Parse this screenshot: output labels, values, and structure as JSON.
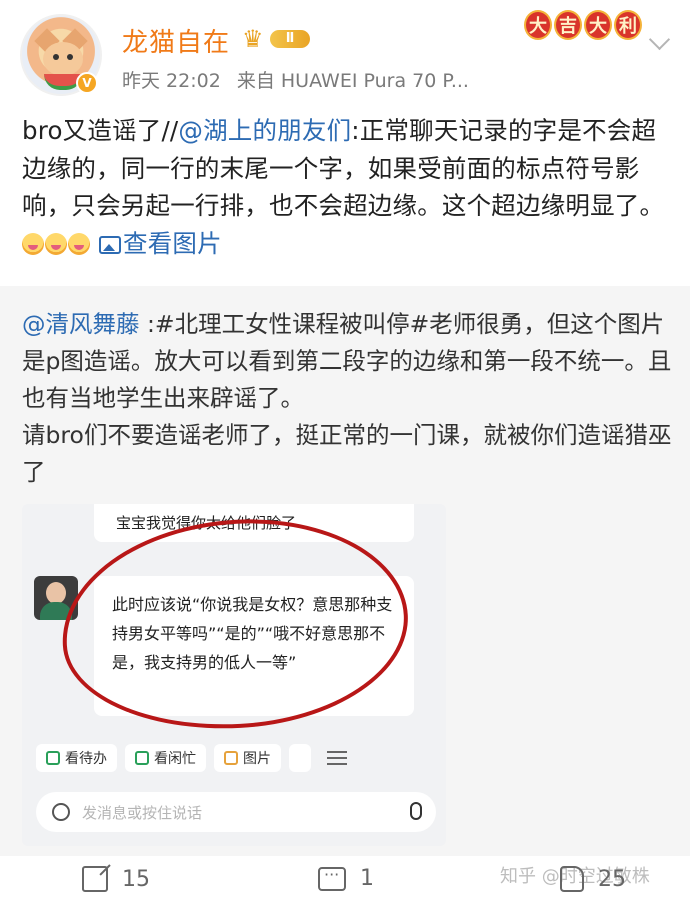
{
  "header": {
    "username": "龙猫自在",
    "level_badge": "Ⅱ",
    "time": "昨天 22:02",
    "source": "来自 HUAWEI Pura 70 P...",
    "luck_banner": [
      "大",
      "吉",
      "大",
      "利"
    ]
  },
  "post": {
    "text_1": "bro又造谣了//",
    "mention": "@湖上的朋友们",
    "text_2": ":正常聊天记录的字是不会超边缘的，同一行的末尾一个字，如果受前面的标点符号影响，只会另起一行排，也不会超边缘。这个超边缘明显了。",
    "view_image": "查看图片"
  },
  "repost": {
    "author": "@清风舞藤",
    "text": " :#北理工女性课程被叫停#老师很勇，但这个图片是p图造谣。放大可以看到第二段字的边缘和第一段不统一。且也有当地学生出来辟谣了。",
    "text_2": "请bro们不要造谣老师了，挺正常的一门课，就被你们造谣猎巫了"
  },
  "chat": {
    "bubble_top": "宝宝我觉得你太给他们脸了",
    "bubble_main": "此时应该说“你说我是女权？意思那种支持男女平等吗”“是的”“哦不好意思那不是，我支持男的低人一等”",
    "toolbar": [
      "看待办",
      "看闲忙",
      "图片"
    ],
    "input_placeholder": "发消息或按住说话"
  },
  "footer": {
    "share_count": "15",
    "comment_count": "1",
    "like_count": "25",
    "watermark": "知乎 @时空过敏株"
  },
  "colors": {
    "username": "#f07a18",
    "link": "#2d6bb3",
    "annotation_circle": "#b81717"
  }
}
